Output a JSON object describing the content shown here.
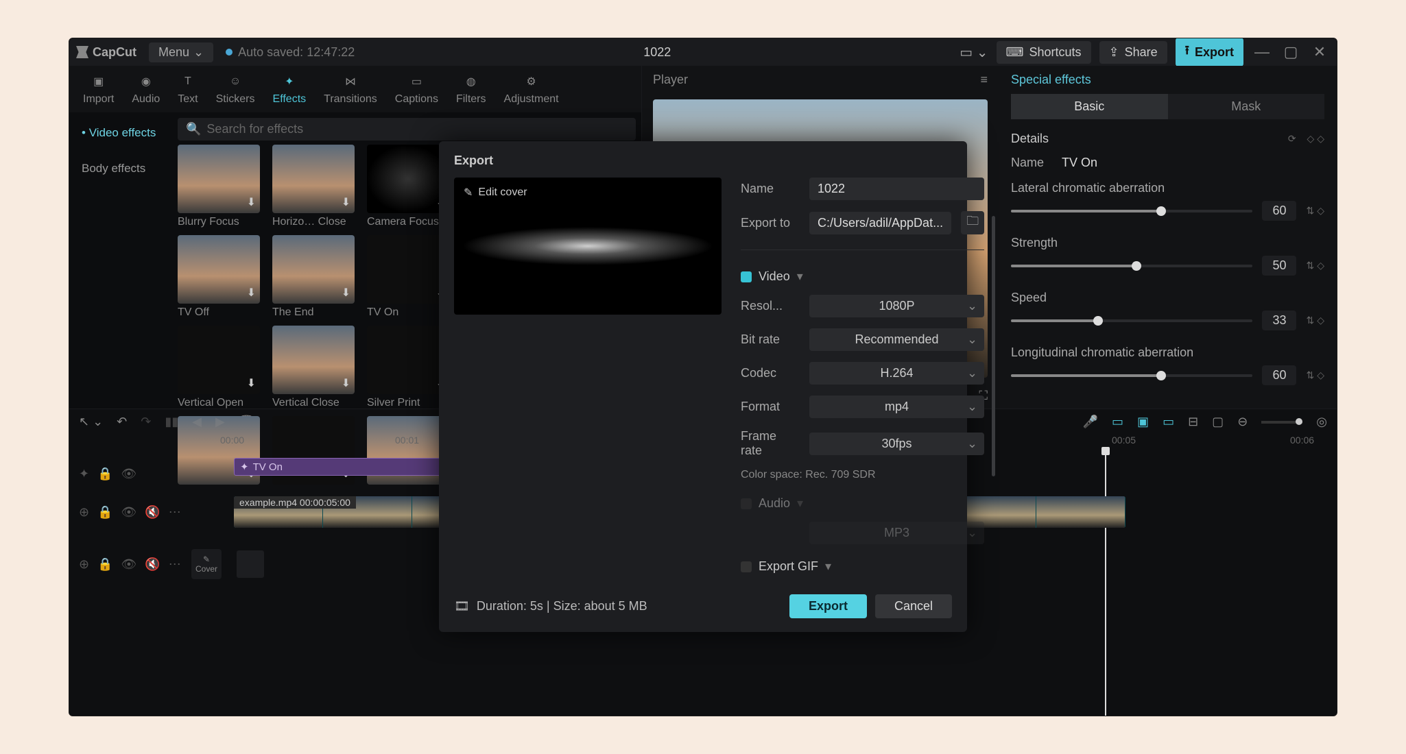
{
  "app": {
    "name": "CapCut",
    "menu": "Menu",
    "autosave": "Auto saved: 12:47:22",
    "project": "1022"
  },
  "titlebar": {
    "shortcuts": "Shortcuts",
    "share": "Share",
    "export": "Export"
  },
  "tabs": {
    "import": "Import",
    "audio": "Audio",
    "text": "Text",
    "stickers": "Stickers",
    "effects": "Effects",
    "transitions": "Transitions",
    "captions": "Captions",
    "filters": "Filters",
    "adjustment": "Adjustment"
  },
  "sidebar": {
    "video_effects": "Video effects",
    "body_effects": "Body effects"
  },
  "search": {
    "placeholder": "Search for effects"
  },
  "effects": [
    {
      "label": "Blurry Focus",
      "dark": false
    },
    {
      "label": "Horizo… Close",
      "dark": false
    },
    {
      "label": "Camera Focus",
      "dark": true,
      "lens": true
    },
    {
      "label": "TV Off",
      "dark": false
    },
    {
      "label": "The End",
      "dark": false
    },
    {
      "label": "TV On",
      "dark": true
    },
    {
      "label": "Vertical Open",
      "dark": true
    },
    {
      "label": "Vertical Close",
      "dark": false
    },
    {
      "label": "Silver Print",
      "dark": true
    },
    {
      "label": "",
      "dark": false
    },
    {
      "label": "",
      "dark": true
    },
    {
      "label": "",
      "dark": false
    }
  ],
  "player": {
    "title": "Player"
  },
  "props": {
    "title": "Special effects",
    "tab_basic": "Basic",
    "tab_mask": "Mask",
    "details": "Details",
    "name_label": "Name",
    "name_value": "TV On",
    "p1": {
      "label": "Lateral chromatic aberration",
      "value": "60",
      "pct": 62
    },
    "p2": {
      "label": "Strength",
      "value": "50",
      "pct": 52
    },
    "p3": {
      "label": "Speed",
      "value": "33",
      "pct": 36
    },
    "p4": {
      "label": "Longitudinal chromatic aberration",
      "value": "60",
      "pct": 62
    }
  },
  "timeline": {
    "t0": "00:00",
    "t1": "00:01",
    "t2": "00:05",
    "t3": "00:06",
    "fx_clip": "TV On",
    "vid_clip": "example.mp4  00:00:05:00",
    "cover": "Cover"
  },
  "export": {
    "title": "Export",
    "edit_cover": "Edit cover",
    "name_label": "Name",
    "name_value": "1022",
    "exportto_label": "Export to",
    "exportto_value": "C:/Users/adil/AppDat...",
    "video": "Video",
    "resolution_label": "Resol...",
    "resolution_value": "1080P",
    "bitrate_label": "Bit rate",
    "bitrate_value": "Recommended",
    "codec_label": "Codec",
    "codec_value": "H.264",
    "format_label": "Format",
    "format_value": "mp4",
    "framerate_label": "Frame rate",
    "framerate_value": "30fps",
    "colorspace": "Color space: Rec. 709 SDR",
    "audio": "Audio",
    "audio_fmt": "MP3",
    "gif": "Export GIF",
    "duration": "Duration: 5s | Size: about 5 MB",
    "export_btn": "Export",
    "cancel_btn": "Cancel"
  }
}
